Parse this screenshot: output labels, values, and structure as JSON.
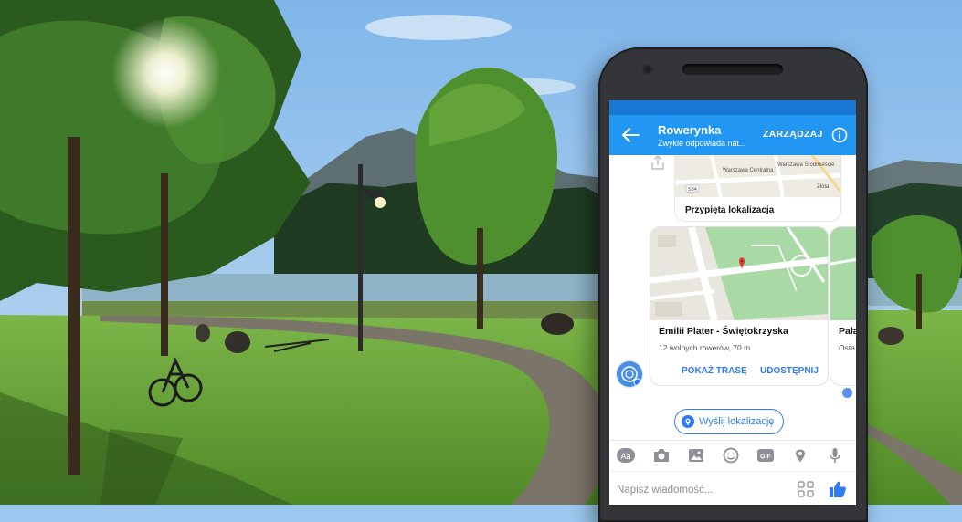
{
  "header": {
    "title": "Rowerynka",
    "subtitle": "Zwykle odpowiada nat...",
    "manage_label": "ZARZĄDZAJ"
  },
  "pinned": {
    "label": "Przypięta lokalizacja",
    "map_labels": [
      "Warszawa Centralna",
      "Warszawa Śródmieście",
      "Złota",
      "S34"
    ]
  },
  "location": {
    "name": "Emilii Plater - Świętokrzyska",
    "info": "12 wolnych rowerów, 70 m",
    "route_label": "POKAŻ TRASĘ",
    "share_label": "UDOSTĘPNIJ"
  },
  "location2": {
    "name": "Pała",
    "info": "Osta"
  },
  "send_location": {
    "label": "Wyślij lokalizację"
  },
  "composer": {
    "placeholder": "Napisz wiadomość..."
  },
  "toolbar": {
    "icons": [
      "text-icon",
      "camera-icon",
      "image-icon",
      "emoji-icon",
      "gif-icon",
      "location-icon",
      "microphone-icon"
    ],
    "text_icon_label": "Aa",
    "gif_icon_label": "GIF"
  },
  "colors": {
    "messenger_blue": "#2196f3",
    "status_bar": "#1976d2",
    "action_blue": "#2f7bf5",
    "map_park": "#a9d9a5",
    "grass": "#6aa83d",
    "sky": "#9cc8ef"
  }
}
